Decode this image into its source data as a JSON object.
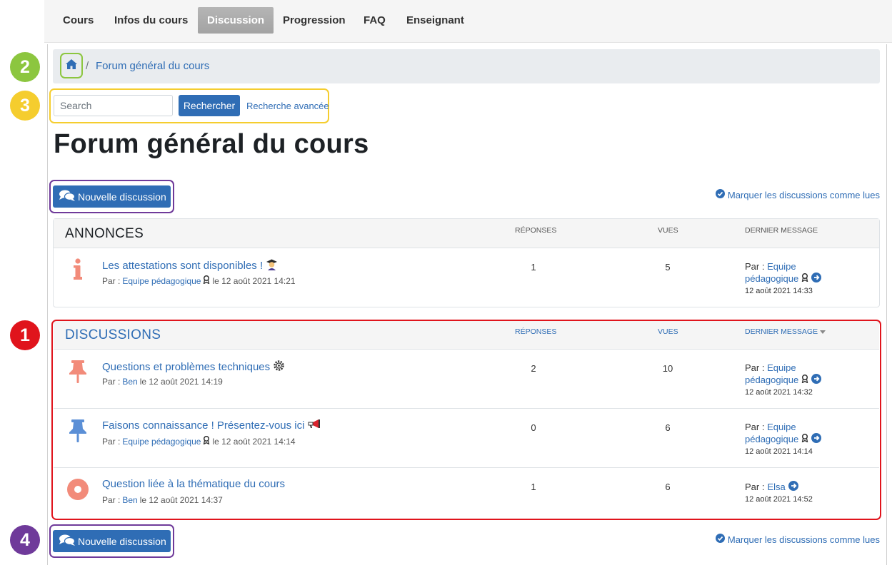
{
  "nav": {
    "tabs": [
      {
        "label": "Cours"
      },
      {
        "label": "Infos du cours"
      },
      {
        "label": "Discussion"
      },
      {
        "label": "Progression"
      },
      {
        "label": "FAQ"
      },
      {
        "label": "Enseignant"
      }
    ],
    "active": "Discussion"
  },
  "breadcrumb": {
    "home_icon": "home-icon",
    "separator": "/",
    "current": "Forum général du cours"
  },
  "search": {
    "placeholder": "Search",
    "button_label": "Rechercher",
    "advanced_link": "Recherche avancée"
  },
  "page_title": "Forum général du cours",
  "actions": {
    "new_discussion_label": "Nouvelle discussion",
    "mark_read_label": "Marquer les discussions comme lues"
  },
  "columns": {
    "replies": "RÉPONSES",
    "views": "VUES",
    "last_message": "DERNIER MESSAGE"
  },
  "announcements": {
    "title": "ANNONCES",
    "rows": [
      {
        "icon": "info-icon",
        "title": "Les attestations sont disponibles !",
        "title_icon": "graduate-emoji",
        "by_label": "Par :",
        "author": "Equipe pédagogique",
        "date": "le 12 août 2021 14:21",
        "replies": "1",
        "views": "5",
        "last_by_label": "Par :",
        "last_author_line1": "Equipe",
        "last_author_line2": "pédagogique",
        "last_date": "12 août 2021 14:33"
      }
    ]
  },
  "discussions": {
    "title": "DISCUSSIONS",
    "rows": [
      {
        "icon": "pin-icon",
        "icon_color": "#f28b7a",
        "title": "Questions et problèmes techniques",
        "title_icon": "gear-emoji",
        "by_label": "Par :",
        "author": "Ben",
        "date": "le 12 août 2021 14:19",
        "replies": "2",
        "views": "10",
        "last_by_label": "Par :",
        "last_author_line1": "Equipe",
        "last_author_line2": "pédagogique",
        "last_date": "12 août 2021 14:32"
      },
      {
        "icon": "pin-icon",
        "icon_color": "#5b8fd6",
        "title": "Faisons connaissance ! Présentez-vous ici",
        "title_icon": "megaphone-emoji",
        "by_label": "Par :",
        "author": "Equipe pédagogique",
        "date": "le 12 août 2021 14:14",
        "replies": "0",
        "views": "6",
        "last_by_label": "Par :",
        "last_author_line1": "Equipe",
        "last_author_line2": "pédagogique",
        "last_date": "12 août 2021 14:14"
      },
      {
        "icon": "circle-dot-icon",
        "icon_color": "#f28b7a",
        "title": "Question liée à la thématique du cours",
        "by_label": "Par :",
        "author": "Ben",
        "date": "le 12 août 2021 14:37",
        "replies": "1",
        "views": "6",
        "last_by_label": "Par :",
        "last_author_line1": "Elsa",
        "last_date": "12 août 2021 14:52"
      }
    ]
  },
  "callouts": [
    {
      "label": "1",
      "color": "#e0141c"
    },
    {
      "label": "2",
      "color": "#8cc63f"
    },
    {
      "label": "3",
      "color": "#f5cd2e"
    },
    {
      "label": "4",
      "color": "#6f3a9a"
    }
  ],
  "colors": {
    "link": "#2f6db5",
    "primary_button": "#2f6db5",
    "active_tab": "#a9a9a9"
  }
}
